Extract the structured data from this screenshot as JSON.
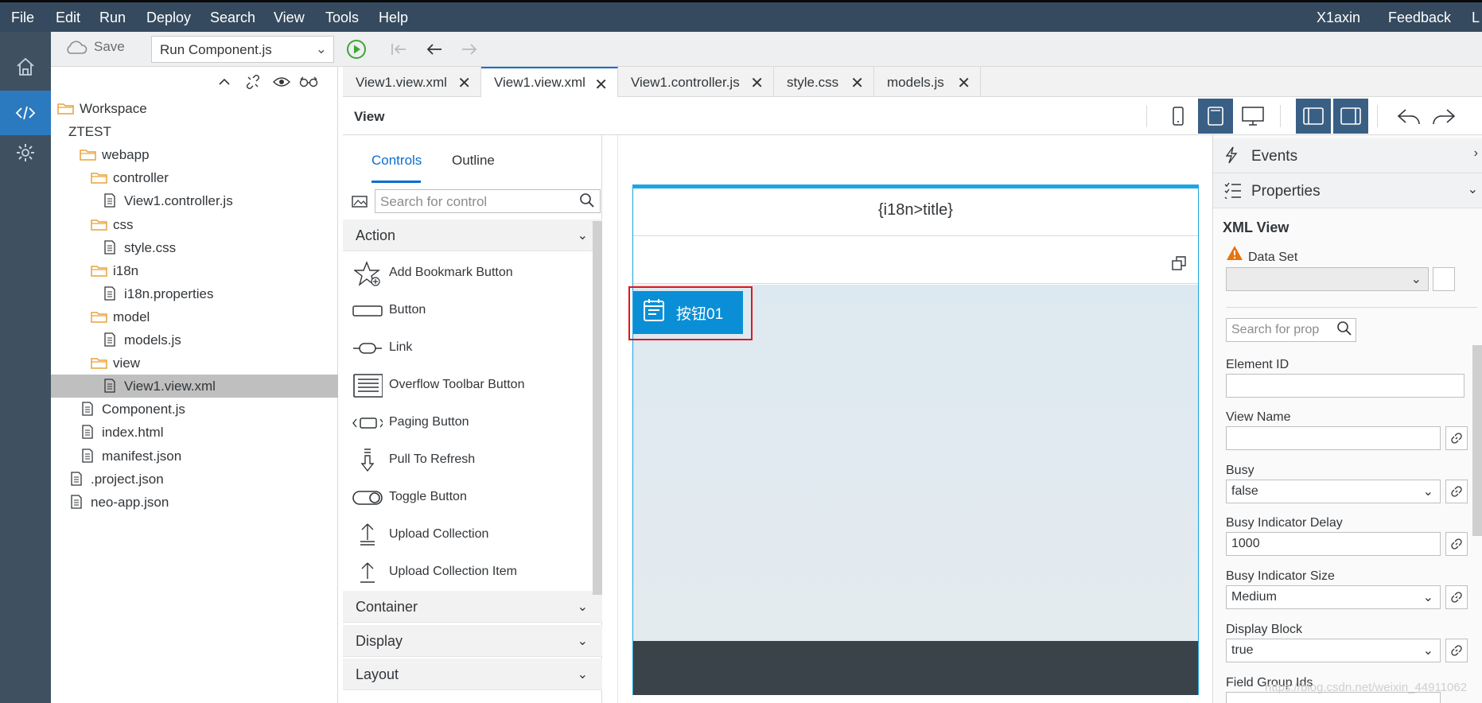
{
  "menu": {
    "items": [
      "File",
      "Edit",
      "Run",
      "Deploy",
      "Search",
      "View",
      "Tools",
      "Help"
    ],
    "user": "X1axin",
    "feedback": "Feedback",
    "overflow": "L"
  },
  "toolbar": {
    "save_label": "Save",
    "run_select": "Run Component.js"
  },
  "tree": {
    "nodes": [
      {
        "label": "Workspace",
        "type": "folder"
      },
      {
        "label": "ZTEST",
        "type": "project"
      },
      {
        "label": "webapp",
        "type": "folder"
      },
      {
        "label": "controller",
        "type": "folder"
      },
      {
        "label": "View1.controller.js",
        "type": "file"
      },
      {
        "label": "css",
        "type": "folder"
      },
      {
        "label": "style.css",
        "type": "file"
      },
      {
        "label": "i18n",
        "type": "folder"
      },
      {
        "label": "i18n.properties",
        "type": "file"
      },
      {
        "label": "model",
        "type": "folder"
      },
      {
        "label": "models.js",
        "type": "file"
      },
      {
        "label": "view",
        "type": "folder"
      },
      {
        "label": "View1.view.xml",
        "type": "file",
        "selected": true
      },
      {
        "label": "Component.js",
        "type": "file"
      },
      {
        "label": "index.html",
        "type": "file"
      },
      {
        "label": "manifest.json",
        "type": "file"
      },
      {
        "label": ".project.json",
        "type": "file"
      },
      {
        "label": "neo-app.json",
        "type": "file"
      }
    ]
  },
  "tabs": [
    {
      "label": "View1.view.xml",
      "active": false
    },
    {
      "label": "View1.view.xml",
      "active": true
    },
    {
      "label": "View1.controller.js",
      "active": false
    },
    {
      "label": "style.css",
      "active": false
    },
    {
      "label": "models.js",
      "active": false
    }
  ],
  "viewbar": {
    "title": "View"
  },
  "palette": {
    "tabs": [
      "Controls",
      "Outline"
    ],
    "search_placeholder": "Search for control",
    "groups": [
      "Action",
      "Container",
      "Display",
      "Layout"
    ],
    "action_items": [
      {
        "label": "Add Bookmark Button",
        "icon": "star-icon"
      },
      {
        "label": "Button",
        "icon": "button-icon"
      },
      {
        "label": "Link",
        "icon": "link-icon"
      },
      {
        "label": "Overflow Toolbar Button",
        "icon": "overflow-toolbar-icon"
      },
      {
        "label": "Paging Button",
        "icon": "paging-icon"
      },
      {
        "label": "Pull To Refresh",
        "icon": "pull-refresh-icon"
      },
      {
        "label": "Toggle Button",
        "icon": "toggle-icon"
      },
      {
        "label": "Upload Collection",
        "icon": "upload-icon"
      },
      {
        "label": "Upload Collection Item",
        "icon": "upload-item-icon"
      }
    ]
  },
  "canvas": {
    "page_title": "{i18n>title}",
    "button_label": "按钮01"
  },
  "props": {
    "events_label": "Events",
    "properties_label": "Properties",
    "section_title": "XML View",
    "data_set_label": "Data Set",
    "search_placeholder": "Search for prop",
    "fields": [
      {
        "label": "Element ID",
        "value": ""
      },
      {
        "label": "View Name",
        "value": ""
      },
      {
        "label": "Busy",
        "value": "false"
      },
      {
        "label": "Busy Indicator Delay",
        "value": "1000"
      },
      {
        "label": "Busy Indicator Size",
        "value": "Medium"
      },
      {
        "label": "Display Block",
        "value": "true"
      },
      {
        "label": "Field Group Ids",
        "value": ""
      }
    ]
  },
  "watermark": "https://blog.csdn.net/weixin_44911062",
  "colors": {
    "accent": "#0a6ed1",
    "menubar": "#354a5f",
    "rail": "#3f5161",
    "button": "#0a8fd6",
    "selection": "#e3141b"
  }
}
